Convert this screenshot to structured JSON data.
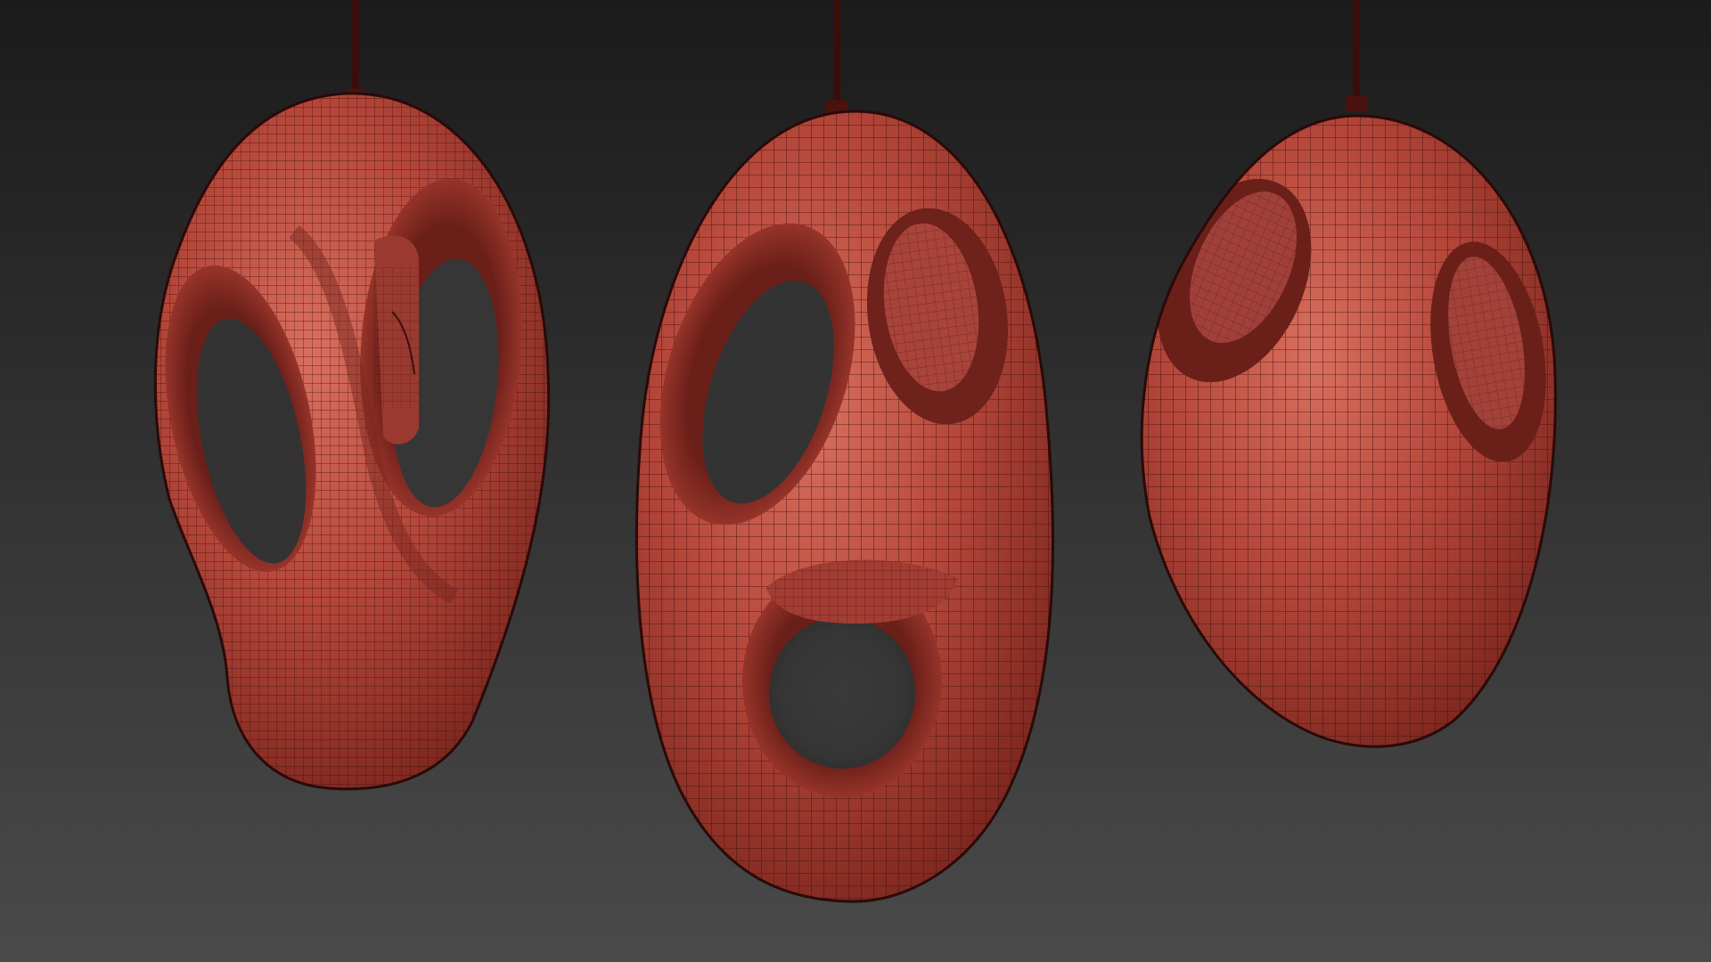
{
  "scene": {
    "background_top": "#1b1b1b",
    "background_bottom": "#4a4a4a",
    "object_color": "#b8473a",
    "object_highlight": "#d76a5c",
    "object_shadow": "#5e1c17",
    "wire_color": "#3b0f0c",
    "cord_color": "#3a0d0b"
  },
  "objects": [
    {
      "name": "left-pendant",
      "holes": 2
    },
    {
      "name": "center-pendant",
      "holes": 3
    },
    {
      "name": "right-pendant",
      "holes": 2
    }
  ]
}
